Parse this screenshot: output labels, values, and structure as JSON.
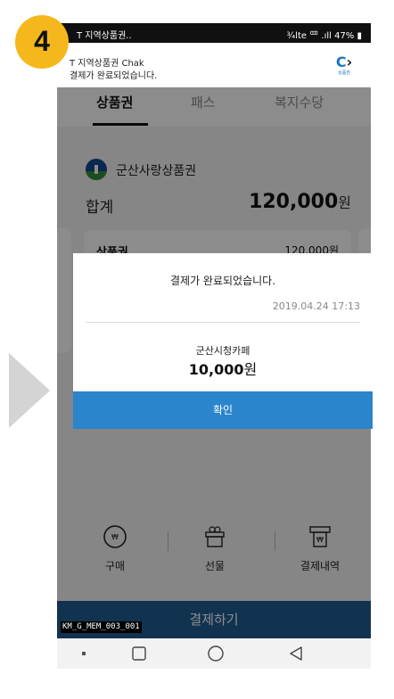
{
  "step_number": "4",
  "status_bar": {
    "left": "T 지역상품권..",
    "right": "¾lte 罒 .ıll 47% ▮"
  },
  "notification": {
    "line1": "T 지역상품권 Chak",
    "line2": "결제가 완료되었습니다.",
    "logo_text": "C",
    "logo_sub": "상품권"
  },
  "tabs": [
    {
      "label": "상품권",
      "active": true
    },
    {
      "label": "패스",
      "active": false
    },
    {
      "label": "복지수당",
      "active": false
    }
  ],
  "brand": {
    "name": "군산사랑상품권"
  },
  "total": {
    "label": "합계",
    "amount": "120,000",
    "unit": "원"
  },
  "card": {
    "label": "상품권",
    "value": "120,000원"
  },
  "actions": [
    {
      "label": "구매",
      "icon": "coin-icon"
    },
    {
      "label": "선물",
      "icon": "gift-icon"
    },
    {
      "label": "결제내역",
      "icon": "receipt-icon"
    }
  ],
  "pay_button": {
    "label": "결제하기"
  },
  "dialog": {
    "title": "결제가 완료되었습니다.",
    "datetime": "2019.04.24 17:13",
    "store": "군산시청카페",
    "amount": "10,000",
    "unit": "원",
    "confirm": "확인"
  },
  "screen_id": "KM_G_MEM_003_001",
  "colors": {
    "accent": "#2b85cc",
    "pay_bar": "#1f5d93",
    "badge": "#f5b81c"
  }
}
